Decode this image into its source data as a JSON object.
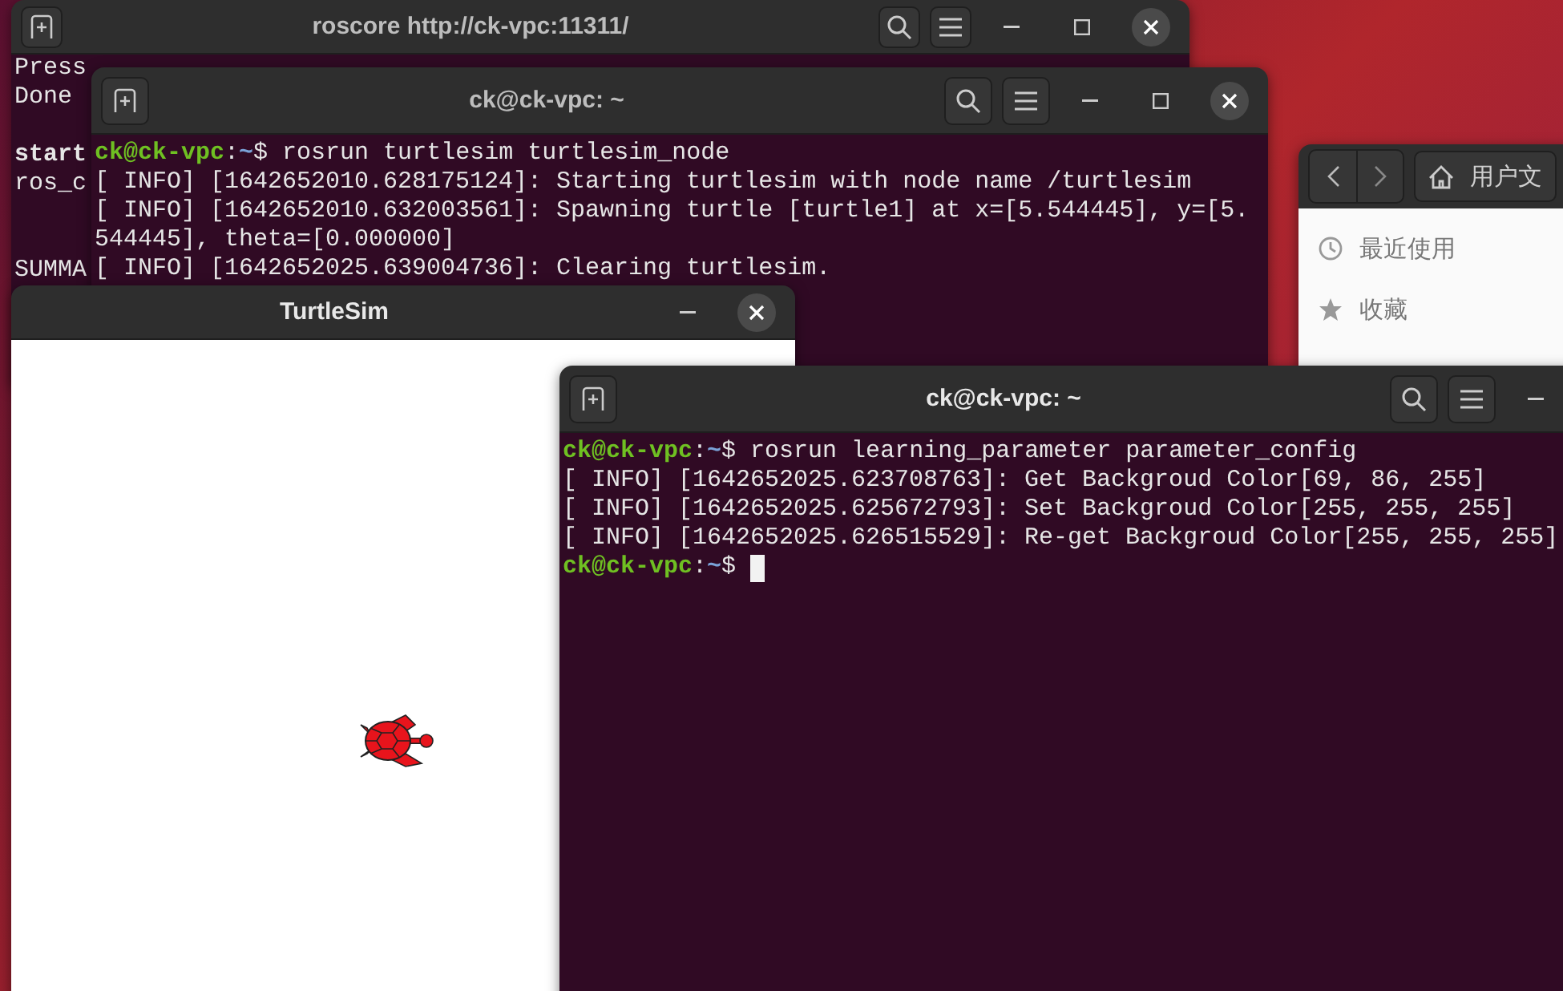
{
  "windows": [
    {
      "kind": "terminal",
      "title": "roscore http://ck-vpc:11311/",
      "lines": [
        {
          "kind": "output",
          "bold": false,
          "text": "Press"
        },
        {
          "kind": "output",
          "bold": false,
          "text": "Done"
        },
        {
          "kind": "blank"
        },
        {
          "kind": "output",
          "bold": true,
          "text": "start"
        },
        {
          "kind": "output",
          "bold": false,
          "text": "ros_c"
        },
        {
          "kind": "blank"
        },
        {
          "kind": "blank"
        },
        {
          "kind": "output",
          "bold": false,
          "text": "SUMMA"
        }
      ]
    },
    {
      "kind": "terminal",
      "title": "ck@ck-vpc: ~",
      "lines": [
        {
          "kind": "prompt",
          "user": "ck@ck-vpc",
          "sep": ":",
          "path": "~",
          "command": "$ rosrun turtlesim turtlesim_node"
        },
        {
          "kind": "output",
          "text": "[ INFO] [1642652010.628175124]: Starting turtlesim with node name /turtlesim"
        },
        {
          "kind": "output",
          "text": "[ INFO] [1642652010.632003561]: Spawning turtle [turtle1] at x=[5.544445], y=[5."
        },
        {
          "kind": "output",
          "text": "544445], theta=[0.000000]"
        },
        {
          "kind": "output",
          "text": "[ INFO] [1642652025.639004736]: Clearing turtlesim."
        }
      ]
    },
    {
      "kind": "turtlesim",
      "title": "TurtleSim"
    },
    {
      "kind": "files",
      "path_label": "用户文",
      "sidebar": [
        {
          "label": "最近使用"
        },
        {
          "label": "收藏"
        }
      ]
    },
    {
      "kind": "terminal",
      "title": "ck@ck-vpc: ~",
      "lines": [
        {
          "kind": "prompt",
          "cursor": false,
          "user": "ck@ck-vpc",
          "sep": ":",
          "path": "~",
          "command": "$ rosrun learning_parameter parameter_config"
        },
        {
          "kind": "output",
          "cursor": false,
          "text": "[ INFO] [1642652025.623708763]: Get Backgroud Color[69, 86, 255]"
        },
        {
          "kind": "output",
          "cursor": false,
          "text": "[ INFO] [1642652025.625672793]: Set Backgroud Color[255, 255, 255]"
        },
        {
          "kind": "output",
          "cursor": false,
          "text": "[ INFO] [1642652025.626515529]: Re-get Backgroud Color[255, 255, 255]"
        },
        {
          "kind": "prompt",
          "cursor": true,
          "user": "ck@ck-vpc",
          "sep": ":",
          "path": "~",
          "command": "$ "
        }
      ]
    }
  ]
}
